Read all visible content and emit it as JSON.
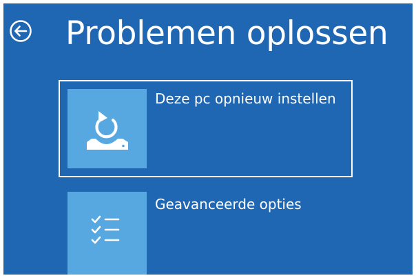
{
  "header": {
    "title": "Problemen oplossen",
    "back_icon": "back-arrow-circle-icon"
  },
  "options": [
    {
      "label": "Deze pc opnieuw instellen",
      "icon": "reset-pc-icon",
      "selected": true
    },
    {
      "label": "Geavanceerde opties",
      "icon": "checklist-icon",
      "selected": false
    }
  ],
  "colors": {
    "background": "#1f66b3",
    "tile_icon_background": "#57a8e0",
    "text": "#ffffff",
    "selection_border": "#ffffff"
  }
}
